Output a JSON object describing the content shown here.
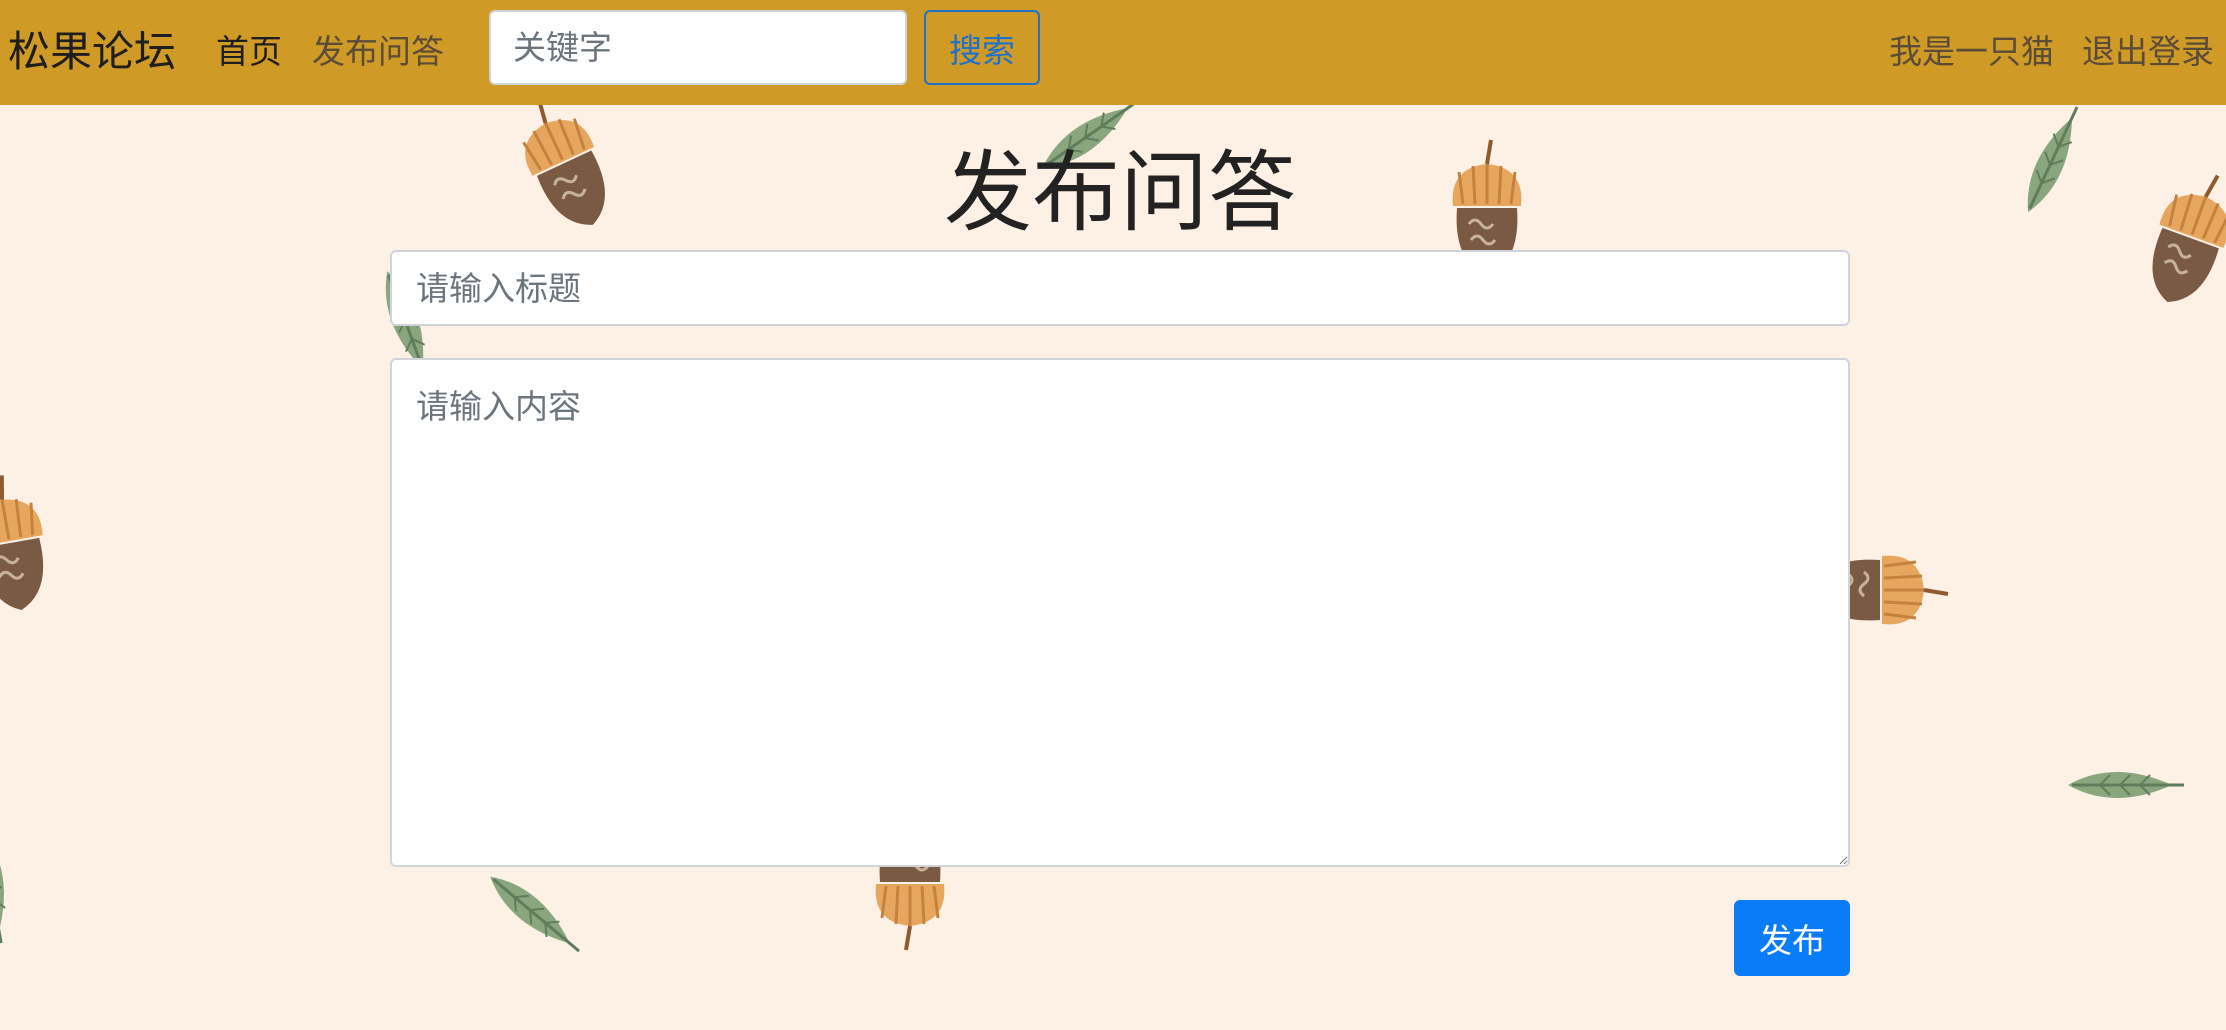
{
  "navbar": {
    "brand": "松果论坛",
    "home_label": "首页",
    "post_label": "发布问答",
    "search_placeholder": "关键字",
    "search_button": "搜索",
    "user_name": "我是一只猫",
    "logout_label": "退出登录"
  },
  "form": {
    "heading": "发布问答",
    "title_placeholder": "请输入标题",
    "content_placeholder": "请输入内容",
    "submit_label": "发布"
  },
  "colors": {
    "navbar": "#d09a27",
    "page_background": "#fdf1e6",
    "primary": "#0a7cf8",
    "search_outline": "#1f72c7"
  },
  "decorations": {
    "background_icons": [
      "acorn-icon",
      "leaf-icon"
    ]
  }
}
